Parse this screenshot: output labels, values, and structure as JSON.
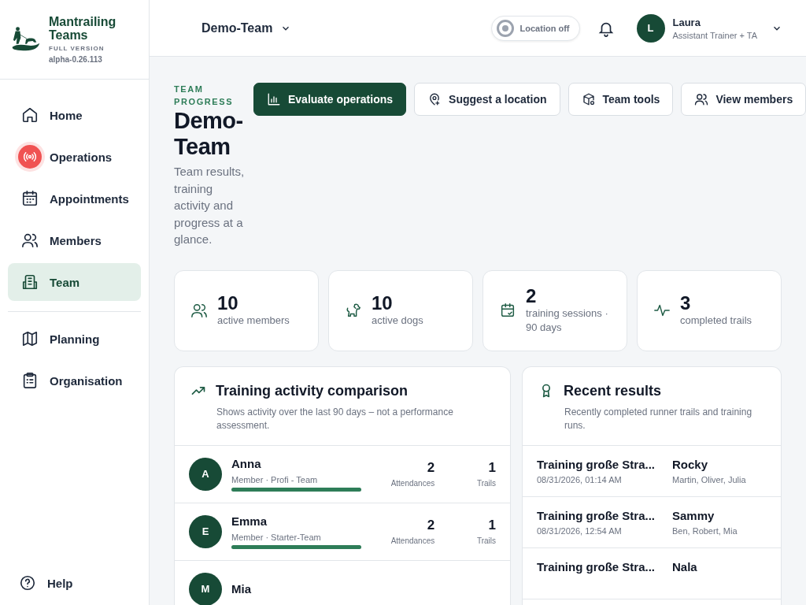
{
  "brand": {
    "name": "Mantrailing Teams",
    "edition": "FULL VERSION",
    "version": "alpha-0.26.113"
  },
  "nav": [
    {
      "label": "Home",
      "selected": false,
      "alert": false
    },
    {
      "label": "Operations",
      "selected": false,
      "alert": true
    },
    {
      "label": "Appointments",
      "selected": false,
      "alert": false
    },
    {
      "label": "Members",
      "selected": false,
      "alert": false
    },
    {
      "label": "Team",
      "selected": true,
      "alert": false
    }
  ],
  "nav_secondary": [
    {
      "label": "Planning",
      "selected": false
    },
    {
      "label": "Organisation",
      "selected": false
    }
  ],
  "help": "Help",
  "topbar": {
    "team": "Demo-Team",
    "location": {
      "label": "Location off",
      "on": false
    },
    "user": {
      "initial": "L",
      "name": "Laura",
      "role": "Assistant Trainer + TA"
    }
  },
  "header": {
    "eyebrow": "TEAM PROGRESS",
    "title": "Demo-Team",
    "description": "Team results, training activity and progress at a glance."
  },
  "actions": [
    {
      "label": "Evaluate operations",
      "primary": true
    },
    {
      "label": "Suggest a location",
      "primary": false
    },
    {
      "label": "Team tools",
      "primary": false
    },
    {
      "label": "View members",
      "primary": false
    }
  ],
  "stats": [
    {
      "value": "10",
      "label": "active members"
    },
    {
      "value": "10",
      "label": "active dogs"
    },
    {
      "value": "2",
      "label": "training sessions · 90 days"
    },
    {
      "value": "3",
      "label": "completed trails"
    }
  ],
  "activity": {
    "title": "Training activity comparison",
    "subtitle": "Shows activity over the last 90 days – not a performance assessment.",
    "rows": [
      {
        "initial": "A",
        "name": "Anna",
        "meta": "Member · Profi - Team",
        "level": 1,
        "attendances": "2",
        "attendances_label": "Attendances",
        "trails": "1",
        "trails_label": "Trails"
      },
      {
        "initial": "E",
        "name": "Emma",
        "meta": "Member · Starter-Team",
        "level": 1,
        "attendances": "2",
        "attendances_label": "Attendances",
        "trails": "1",
        "trails_label": "Trails"
      },
      {
        "initial": "M",
        "name": "Mia"
      }
    ]
  },
  "results": {
    "title": "Recent results",
    "subtitle": "Recently completed runner trails and training runs.",
    "rows": [
      {
        "trail": "Training große Stra...",
        "time": "08/31/2026, 01:14 AM",
        "dog": "Rocky",
        "people": "Martin, Oliver, Julia"
      },
      {
        "trail": "Training große Stra...",
        "time": "08/31/2026, 12:54 AM",
        "dog": "Sammy",
        "people": "Ben, Robert, Mia"
      },
      {
        "trail": "Training große Stra...",
        "dog": "Nala"
      }
    ]
  }
}
